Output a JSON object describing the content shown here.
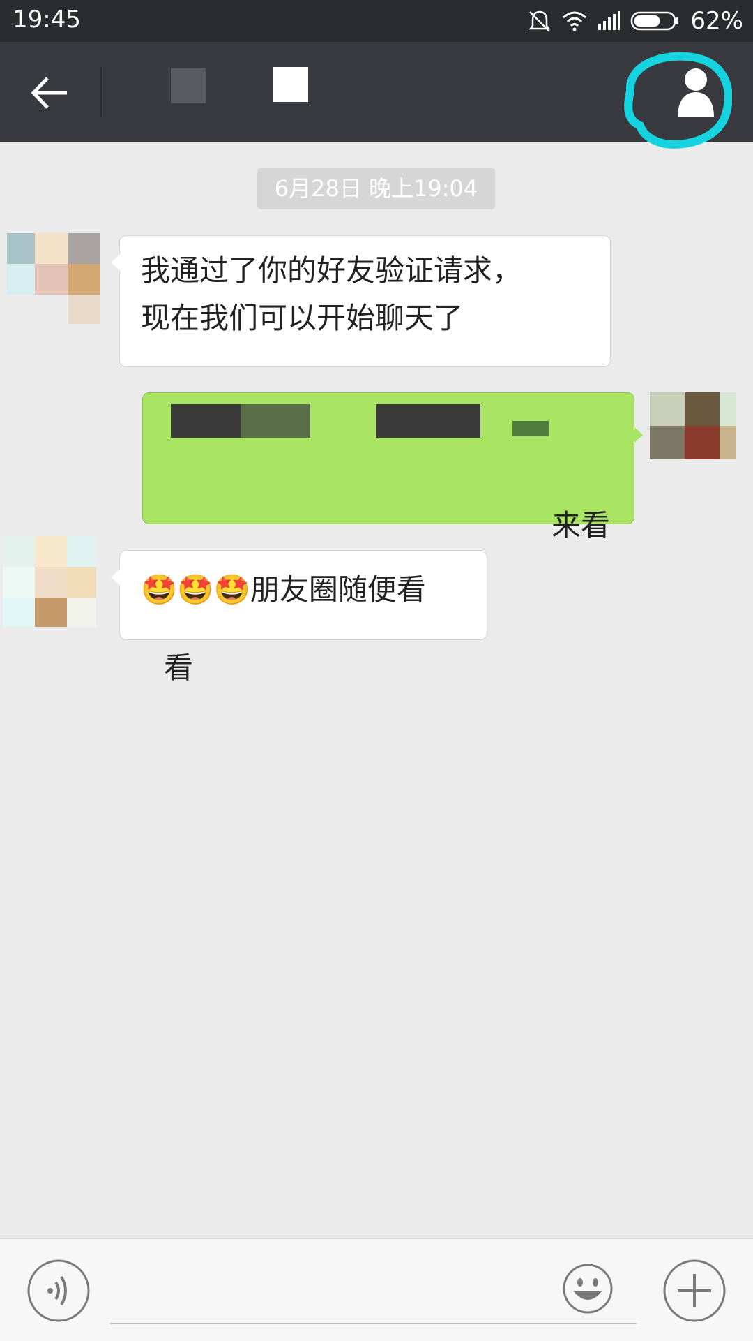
{
  "status_bar": {
    "time": "19:45",
    "battery_percent": "62%",
    "icons": [
      "mute-alarm-icon",
      "wifi-icon",
      "signal-icon",
      "battery-icon"
    ]
  },
  "header": {
    "back_icon": "arrow-left-icon",
    "profile_icon": "person-icon",
    "highlight_color": "#16d3e0"
  },
  "chat": {
    "timestamp": "6月28日 晚上19:04",
    "messages": [
      {
        "side": "in",
        "text": "我通过了你的好友验证请求，\n现在我们可以开始聊天了"
      },
      {
        "side": "out",
        "text": "来看\n看"
      },
      {
        "side": "in",
        "text": "🤩🤩🤩朋友圈随便看"
      }
    ]
  },
  "input_bar": {
    "voice_icon": "voice-icon",
    "emoji_icon": "smiley-icon",
    "plus_icon": "plus-icon"
  },
  "colors": {
    "header_bg": "#393a3f",
    "chat_bg": "#ebebeb",
    "sent_bubble": "#a9e563",
    "received_bubble": "#ffffff"
  }
}
